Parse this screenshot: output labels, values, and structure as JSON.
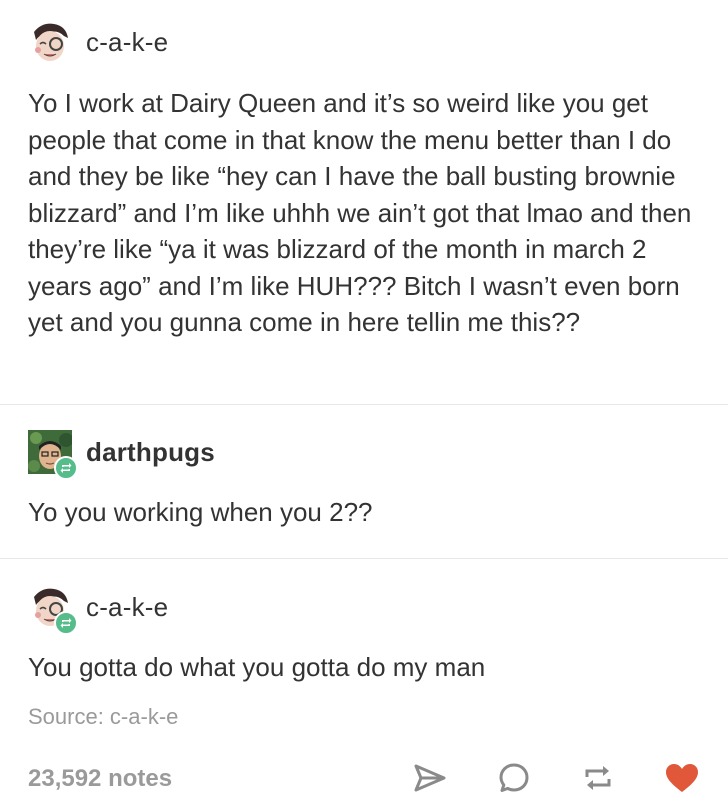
{
  "posts": [
    {
      "username": "c-a-k-e",
      "body": "Yo I work at Dairy Queen and it’s so weird like you get people that come in that know the menu better than I do and they be like “hey can I have the ball busting brownie blizzard” and I’m like uhhh we ain’t got that lmao and then they’re like “ya it was blizzard of the month in march 2 years ago” and I’m like HUH??? Bitch I wasn’t even born yet and you gunna come in here tellin me this??"
    },
    {
      "username": "darthpugs",
      "body": "Yo you working when you 2??"
    },
    {
      "username": "c-a-k-e",
      "body": "You gotta do what you gotta do my man"
    }
  ],
  "footer": {
    "source": "Source: c-a-k-e",
    "notes": "23,592 notes"
  },
  "icons": {
    "share": "paper-plane-icon",
    "reply": "speech-bubble-icon",
    "reblog": "reblog-icon",
    "like": "heart-icon"
  },
  "colors": {
    "reblog_badge": "#56bc8a",
    "like": "#e0573a",
    "muted": "#9a9a9a",
    "text": "#333333"
  }
}
